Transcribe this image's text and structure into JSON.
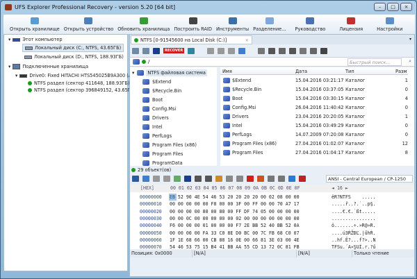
{
  "window": {
    "title": "UFS Explorer Professional Recovery - version 5.20 [64 bit]"
  },
  "toolbar": [
    {
      "label": "Открыть хранилище",
      "color": "#5a9bd0"
    },
    {
      "label": "Открыть устройство",
      "color": "#4f7fb8"
    },
    {
      "label": "Обновить хранилища",
      "color": "#3a9a3a"
    },
    {
      "label": "Построить RAID",
      "color": "#444444"
    },
    {
      "label": "Инструменты",
      "color": "#3c6fa8"
    },
    {
      "label": "Разделение...",
      "color": "#7fa8d8"
    },
    {
      "label": "Руководство",
      "color": "#4a72b0"
    },
    {
      "label": "Лицензия",
      "color": "#c03030"
    },
    {
      "label": "Настройки",
      "color": "#5a8fc8"
    }
  ],
  "left": {
    "computer": "Этот компьютер",
    "disks": [
      "Локальный диск (C:, NTFS, 43.65ГБ)",
      "Локальный диск (D:, NTFS, 188.93ГБ)"
    ],
    "connected": "Подключенные хранилища",
    "drive": "Drive0: Fixed HITACHI HTS545025B9A300 (ATA",
    "partitions": [
      "NTFS раздел (сектор 411648, 188.93ГБ)",
      "NTFS раздел (сектор 396849152, 43.65ГБ)"
    ]
  },
  "tab": {
    "label": "NTFS [0-91545600 на Local Disk (C:)]",
    "close": "×"
  },
  "path": {
    "value": "/",
    "search_placeholder": "Быстрый поиск..."
  },
  "recover_label": "RECOVER",
  "tree": {
    "root": "NTFS файловая система",
    "items": [
      "$Extend",
      "$Recycle.Bin",
      "Boot",
      "Config.Msi",
      "Drivers",
      "Intel",
      "PerfLogs",
      "Program Files (x86)",
      "Program Files",
      "ProgramData"
    ]
  },
  "files": {
    "columns": [
      "Имя",
      "Дата",
      "Тип",
      "Разм"
    ],
    "rows": [
      [
        "$Extend",
        "15.04.2016 03:21:17",
        "Каталог",
        "1"
      ],
      [
        "$Recycle.Bin",
        "15.04.2016 03:37:05",
        "Каталог",
        "0"
      ],
      [
        "Boot",
        "15.04.2016 03:30:15",
        "Каталог",
        "4"
      ],
      [
        "Config.Msi",
        "26.04.2016 11:40:42",
        "Каталог",
        "0"
      ],
      [
        "Drivers",
        "23.04.2016 20:20:05",
        "Каталог",
        "1"
      ],
      [
        "Intel",
        "15.04.2016 03:49:29",
        "Каталог",
        "0"
      ],
      [
        "PerfLogs",
        "14.07.2009 07:20:08",
        "Каталог",
        "0"
      ],
      [
        "Program Files (x86)",
        "27.04.2016 01:02:07",
        "Каталог",
        "12"
      ],
      [
        "Program Files",
        "27.04.2016 01:04:17",
        "Каталог",
        "8"
      ]
    ]
  },
  "status": "29 объект(ов)",
  "hex": {
    "encoding": "ANSI - Central European / CP-1250",
    "header_label": "[HEX]",
    "columns": "00 01 02 03 04 05 06 07 08 09 0A 0B 0C 0D 0E 0F",
    "width": "◄ 16 ►",
    "rows": [
      {
        "addr": "00000000",
        "bytes": "EB 52 90 4E 54 46 53 20 20 20 20 00 02 08 00 00",
        "text": "ëR?NTFS    ....."
      },
      {
        "addr": "00000010",
        "bytes": "00 00 00 00 00 F8 00 00 3F 00 FF 00 00 70 A7 17",
        "text": ".....ř..?.˙..p§."
      },
      {
        "addr": "00000020",
        "bytes": "00 00 00 00 80 00 80 00 FF DF 74 05 00 00 00 00",
        "text": "....€.€.˙ßt....."
      },
      {
        "addr": "00000030",
        "bytes": "00 00 0C 00 00 00 00 00 02 00 00 00 00 00 00 00",
        "text": "................"
      },
      {
        "addr": "00000040",
        "bytes": "F6 00 00 00 01 00 00 00 F7 2E BB 52 40 BB 52 0A",
        "text": "ö.......÷.»R@»R."
      },
      {
        "addr": "00000050",
        "bytes": "00 00 00 00 FA 33 C0 8E D0 BC 00 7C FB 68 C0 07",
        "text": "....ú3ŔŽĐĽ.|űhŔ."
      },
      {
        "addr": "00000060",
        "bytes": "1F 1E 68 66 00 CB 88 16 0E 00 66 81 3E 03 00 4E",
        "text": "..hf.Ë?...f?>..N"
      },
      {
        "addr": "00000070",
        "bytes": "54 46 53 75 15 B4 41 BB AA 55 CD 13 72 0C 81 FB",
        "text": "TFSu.´A»ŞUÍ.r.?ű"
      }
    ]
  },
  "hex_status": {
    "position": "Позиция: 0x0000",
    "field2": "[N/A]",
    "field3": "[N/A]",
    "mode": "Только чтение"
  }
}
